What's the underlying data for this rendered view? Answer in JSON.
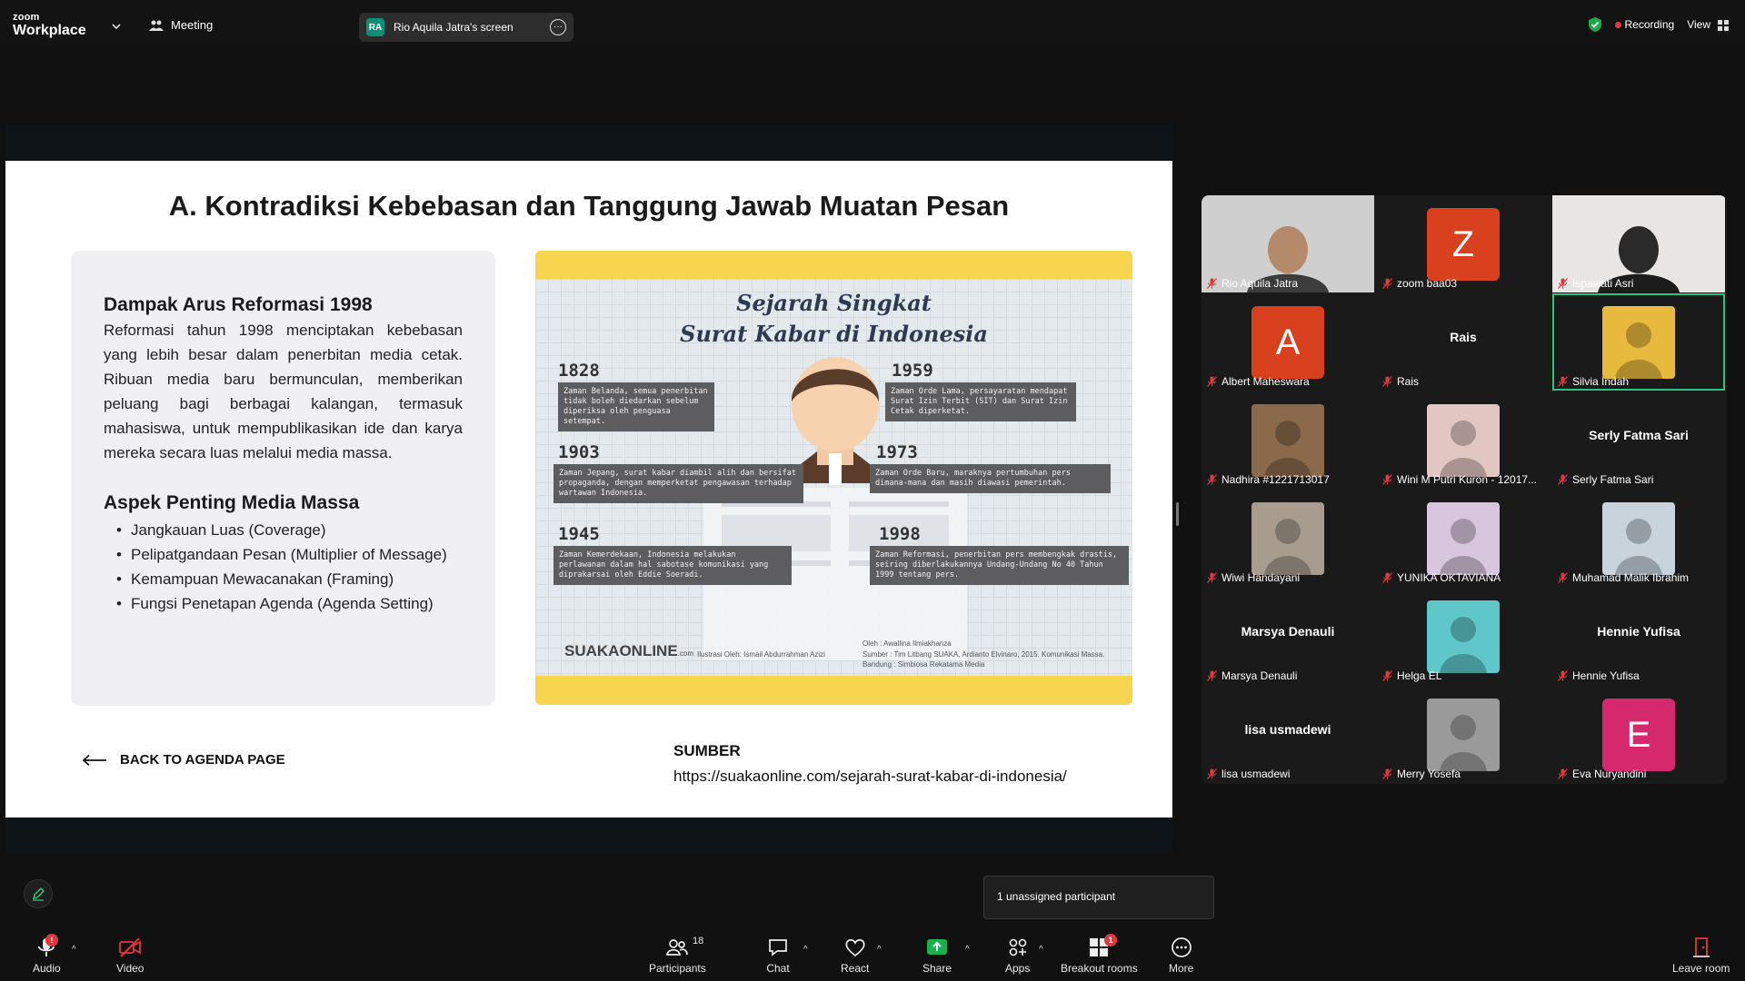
{
  "app": {
    "logo_small": "zoom",
    "logo_big": "Workplace",
    "meeting_label": "Meeting",
    "screen_initials": "RA",
    "screen_label": "Rio Aquila Jatra's screen",
    "recording_label": "Recording",
    "view_label": "View"
  },
  "slide": {
    "title": "A. Kontradiksi Kebebasan dan Tanggung Jawab Muatan Pesan",
    "heading1": "Dampak Arus Reformasi 1998",
    "paragraph1": "Reformasi tahun 1998 menciptakan kebebasan yang lebih besar dalam penerbitan media cetak. Ribuan media baru bermunculan, memberikan peluang bagi berbagai kalangan, termasuk mahasiswa, untuk mempublikasikan ide dan karya mereka secara luas melalui media massa.",
    "heading2": "Aspek Penting Media Massa",
    "bullets": [
      "Jangkauan Luas (Coverage)",
      "Pelipatgandaan Pesan (Multiplier of Message)",
      "Kemampuan Mewacanakan (Framing)",
      "Fungsi Penetapan Agenda (Agenda Setting)"
    ],
    "back_label": "BACK TO AGENDA PAGE",
    "source_label": "SUMBER",
    "source_url": "https://suakaonline.com/sejarah-surat-kabar-di-indonesia/",
    "infographic": {
      "title_line1": "Sejarah Singkat",
      "title_line2": "Surat Kabar di Indonesia",
      "entries": [
        {
          "year": "1828",
          "text": "Zaman Belanda, semua penerbitan tidak boleh diedarkan sebelum diperiksa oleh penguasa setempat."
        },
        {
          "year": "1959",
          "text": "Zaman Orde Lama, persayaratan mendapat Surat Izin Terbit (SIT) dan Surat Izin Cetak diperketat."
        },
        {
          "year": "1903",
          "text": "Zaman Jepang, surat kabar diambil alih dan bersifat propaganda, dengan memperketat pengawasan terhadap wartawan Indonesia."
        },
        {
          "year": "1973",
          "text": "Zaman Orde Baru, maraknya pertumbuhan pers dimana-mana dan masih diawasi pemerintah."
        },
        {
          "year": "1945",
          "text": "Zaman Kemerdekaan, Indonesia melakukan perlawanan dalam hal sabotase komunikasi yang diprakarsai oleh Eddie Soeradi."
        },
        {
          "year": "1998",
          "text": "Zaman Reformasi, penerbitan pers membengkak drastis, seiring diberlakukannya Undang-Undang No 40 Tahun 1999 tentang pers."
        }
      ],
      "logo": "SUAKAONLINE",
      "logo_suffix": ".com",
      "illustrator": "Ilustrasi Oleh: Ismail Abdurrahman Azizi",
      "author": "Oleh : Awallina Ilmiakhanza",
      "sources": "Sumber : Tim Litbang SUAKA, Ardianto Elvinaro, 2015. Komunikasi Massa. Bandung : Simbiosa Rekatama Media"
    }
  },
  "participants": [
    {
      "name": "Rio Aquila Jatra",
      "kind": "photo",
      "color": "#cfcfcf"
    },
    {
      "name": "zoom baa03",
      "kind": "letter",
      "letter": "Z",
      "color": "#d9411e"
    },
    {
      "name": "Ispawati Asri",
      "kind": "photo",
      "color": "#e8e6e4"
    },
    {
      "name": "Albert Maheswara",
      "kind": "letter",
      "letter": "A",
      "color": "#d9411e"
    },
    {
      "name": "Rais",
      "kind": "text",
      "display": "Rais"
    },
    {
      "name": "Silvia Indah",
      "kind": "photo",
      "color": "#e7b93c",
      "active": true
    },
    {
      "name": "Nadhira #1221713017",
      "kind": "photo",
      "color": "#8a6a4a"
    },
    {
      "name": "Wini M Putri Kuron - 12017...",
      "kind": "photo",
      "color": "#e2c6c2"
    },
    {
      "name": "Serly Fatma Sari",
      "kind": "text",
      "display": "Serly Fatma Sari"
    },
    {
      "name": "Wiwi Handayani",
      "kind": "photo",
      "color": "#a79c8e"
    },
    {
      "name": "YUNIKA OKTAVIANA",
      "kind": "photo",
      "color": "#d8c6df"
    },
    {
      "name": "Muhamad Malik Ibrahim",
      "kind": "photo",
      "color": "#c9d3dc"
    },
    {
      "name": "Marsya Denauli",
      "kind": "text",
      "display": "Marsya Denauli"
    },
    {
      "name": "Helga EL",
      "kind": "photo",
      "color": "#5fc6c9"
    },
    {
      "name": "Hennie Yufisa",
      "kind": "text",
      "display": "Hennie Yufisa"
    },
    {
      "name": "lisa usmadewi",
      "kind": "text",
      "display": "lisa usmadewi"
    },
    {
      "name": "Merry Yosefa",
      "kind": "photo",
      "color": "#9a9a9a"
    },
    {
      "name": "Eva Nuryandini",
      "kind": "letter",
      "letter": "E",
      "color": "#d6286c"
    }
  ],
  "unassigned": "1 unassigned participant",
  "toolbar": {
    "audio": "Audio",
    "audio_badge": "!",
    "video": "Video",
    "participants": "Participants",
    "participants_count": "18",
    "chat": "Chat",
    "react": "React",
    "share": "Share",
    "apps": "Apps",
    "breakout": "Breakout rooms",
    "breakout_badge": "1",
    "more": "More",
    "leave": "Leave room"
  },
  "colors": {
    "accent_green": "#2ec27e",
    "recording_red": "#e0383e",
    "share_green": "#17b14d"
  }
}
